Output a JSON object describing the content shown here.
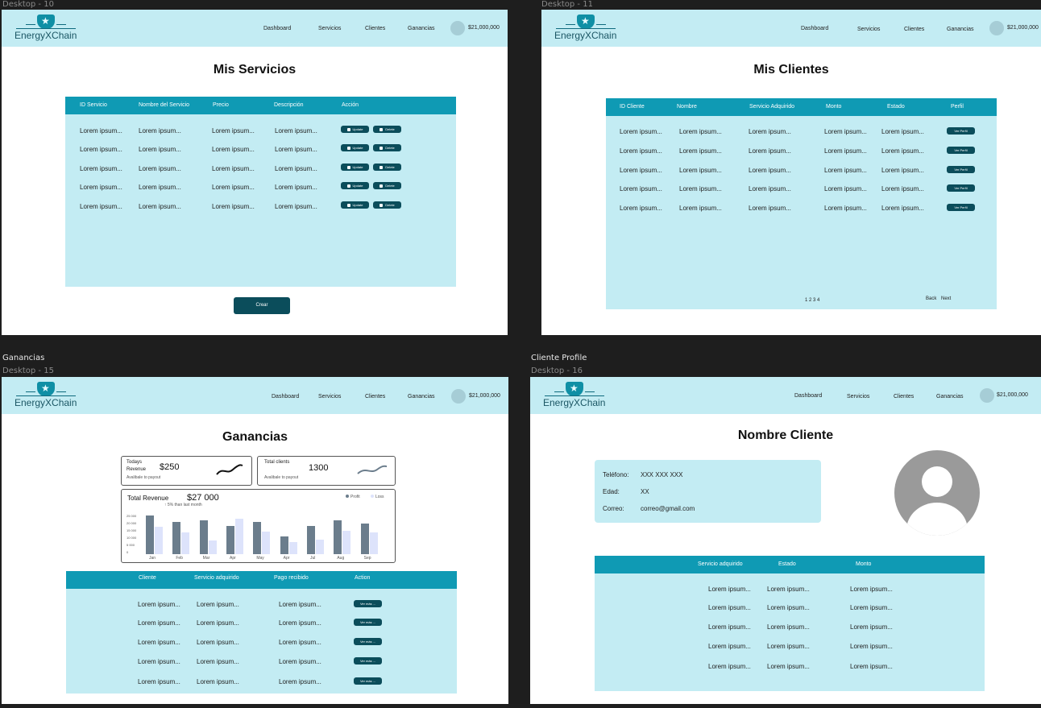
{
  "frames": {
    "f10": {
      "label": "Desktop - 10"
    },
    "f11": {
      "label": "Desktop - 11"
    },
    "f15": {
      "label": "Desktop - 15",
      "section": "Ganancias"
    },
    "f16": {
      "label": "Desktop - 16",
      "section": "Cliente Profile"
    }
  },
  "brand": {
    "name": "EnergyXChain"
  },
  "nav": {
    "dashboard": "Dashboard",
    "servicios": "Servicios",
    "clientes": "Clientes",
    "ganancias": "Ganancias",
    "balance": "$21,000,000"
  },
  "servicios": {
    "title": "Mis Servicios",
    "headers": [
      "ID Servicio",
      "Nombre del Servicio",
      "Precio",
      "Descripción",
      "Acción"
    ],
    "rows": [
      [
        "Lorem ipsum...",
        "Lorem ipsum...",
        "Lorem ipsum...",
        "Lorem ipsum..."
      ],
      [
        "Lorem ipsum...",
        "Lorem ipsum...",
        "Lorem ipsum...",
        "Lorem ipsum..."
      ],
      [
        "Lorem ipsum...",
        "Lorem ipsum...",
        "Lorem ipsum...",
        "Lorem ipsum..."
      ],
      [
        "Lorem ipsum...",
        "Lorem ipsum...",
        "Lorem ipsum...",
        "Lorem ipsum..."
      ],
      [
        "Lorem ipsum...",
        "Lorem ipsum...",
        "Lorem ipsum...",
        "Lorem ipsum..."
      ]
    ],
    "update_label": "Update",
    "delete_label": "Delete",
    "create_label": "Crear"
  },
  "clientes": {
    "title": "Mis Clientes",
    "headers": [
      "ID Cliente",
      "Nombre",
      "Servicio Adquirido",
      "Monto",
      "Estado",
      "Perfil"
    ],
    "rows": [
      [
        "Lorem ipsum...",
        "Lorem ipsum...",
        "Lorem ipsum...",
        "Lorem ipsum...",
        "Lorem ipsum..."
      ],
      [
        "Lorem ipsum...",
        "Lorem ipsum...",
        "Lorem ipsum...",
        "Lorem ipsum...",
        "Lorem ipsum..."
      ],
      [
        "Lorem ipsum...",
        "Lorem ipsum...",
        "Lorem ipsum...",
        "Lorem ipsum...",
        "Lorem ipsum..."
      ],
      [
        "Lorem ipsum...",
        "Lorem ipsum...",
        "Lorem ipsum...",
        "Lorem ipsum...",
        "Lorem ipsum..."
      ],
      [
        "Lorem ipsum...",
        "Lorem ipsum...",
        "Lorem ipsum...",
        "Lorem ipsum...",
        "Lorem ipsum..."
      ]
    ],
    "profile_btn": "Ver Perfil",
    "pages": "1 2 3 4",
    "back": "Back",
    "next": "Next"
  },
  "ganancias": {
    "title": "Ganancias",
    "today_label_1": "Todays",
    "today_label_2": "Revenue",
    "today_value": "$250",
    "today_sub": "Avalibale to payout",
    "clients_label": "Total clients",
    "clients_value": "1300",
    "clients_sub": "Avalibale to payout",
    "total_label": "Total Revenue",
    "total_value": "$27 000",
    "total_sub": "5% than last month",
    "legend_profit": "Profit",
    "legend_loss": "Loss",
    "headers": [
      "Cliente",
      "Servicio adquirido",
      "Pago recibido",
      "Action"
    ],
    "rows": [
      [
        "Lorem ipsum...",
        "Lorem ipsum...",
        "Lorem ipsum..."
      ],
      [
        "Lorem ipsum...",
        "Lorem ipsum...",
        "Lorem ipsum..."
      ],
      [
        "Lorem ipsum...",
        "Lorem ipsum...",
        "Lorem ipsum..."
      ],
      [
        "Lorem ipsum...",
        "Lorem ipsum...",
        "Lorem ipsum..."
      ],
      [
        "Lorem ipsum...",
        "Lorem ipsum...",
        "Lorem ipsum..."
      ]
    ],
    "action_btn": "Ver más ..."
  },
  "chart_data": {
    "type": "bar",
    "categories": [
      "Jan",
      "Feb",
      "Mar",
      "Apr",
      "May",
      "Apr",
      "Jul",
      "Aug",
      "Sep"
    ],
    "y_ticks": [
      "25 000",
      "20 000",
      "15 000",
      "10 000",
      "5 000",
      "0"
    ],
    "ylim": [
      0,
      25000
    ],
    "series": [
      {
        "name": "Profit",
        "color": "#6b7d8c",
        "values": [
          24000,
          20000,
          21000,
          17500,
          20000,
          11000,
          17500,
          21000,
          19000
        ]
      },
      {
        "name": "Loss",
        "color": "#dde3fb",
        "values": [
          17000,
          13500,
          8500,
          22000,
          14000,
          7500,
          9000,
          14500,
          13500
        ]
      }
    ]
  },
  "profile": {
    "title": "Nombre Cliente",
    "phone_label": "Teléfono:",
    "phone_value": "XXX XXX XXX",
    "age_label": "Edad:",
    "age_value": "XX",
    "email_label": "Correo:",
    "email_value": "correo@gmail.com",
    "headers": [
      "Servicio adquirido",
      "Estado",
      "Monto"
    ],
    "rows": [
      [
        "Lorem ipsum...",
        "Lorem ipsum...",
        "Lorem ipsum..."
      ],
      [
        "Lorem ipsum...",
        "Lorem ipsum...",
        "Lorem ipsum..."
      ],
      [
        "Lorem ipsum...",
        "Lorem ipsum...",
        "Lorem ipsum..."
      ],
      [
        "Lorem ipsum...",
        "Lorem ipsum...",
        "Lorem ipsum..."
      ],
      [
        "Lorem ipsum...",
        "Lorem ipsum...",
        "Lorem ipsum..."
      ]
    ]
  }
}
